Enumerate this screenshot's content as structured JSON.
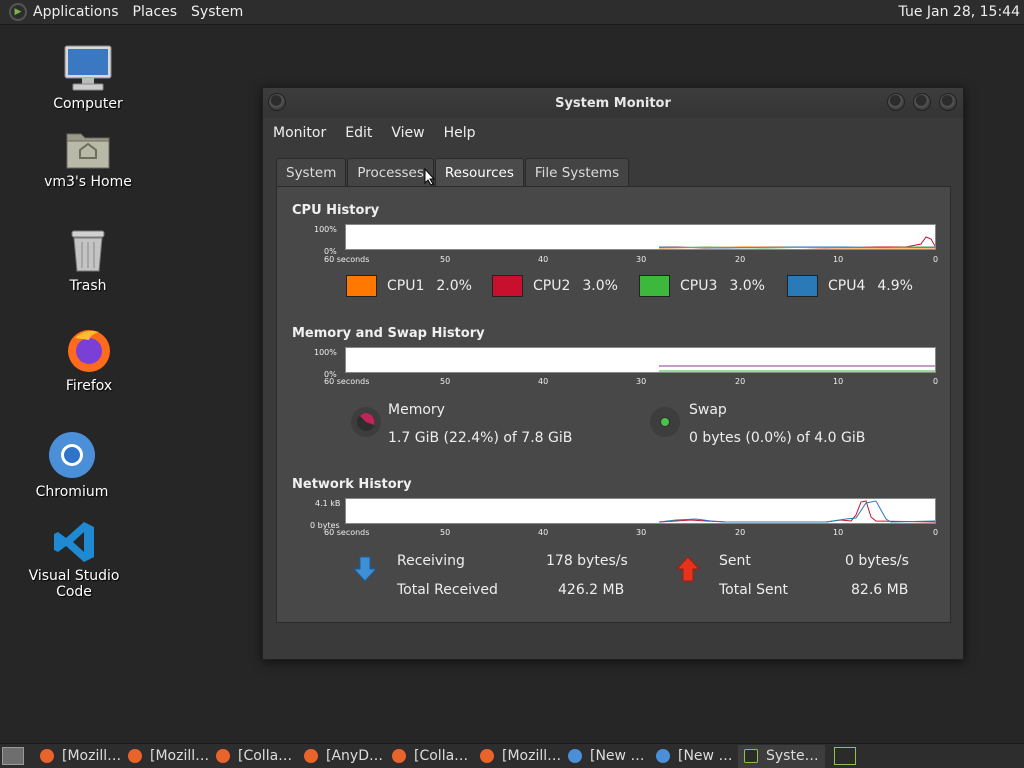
{
  "top_panel": {
    "menus": [
      "Applications",
      "Places",
      "System"
    ],
    "clock": "Tue Jan 28, 15:44"
  },
  "desktop_icons": [
    {
      "label": "Computer",
      "icon": "computer-icon"
    },
    {
      "label": "vm3's Home",
      "icon": "home-folder-icon"
    },
    {
      "label": "Trash",
      "icon": "trash-icon"
    },
    {
      "label": "Firefox",
      "icon": "firefox-icon"
    },
    {
      "label": "Chromium",
      "icon": "chromium-icon"
    },
    {
      "label": "Visual Studio Code",
      "icon": "vscode-icon"
    }
  ],
  "window": {
    "title": "System Monitor",
    "menubar": [
      "Monitor",
      "Edit",
      "View",
      "Help"
    ],
    "tabs": [
      "System",
      "Processes",
      "Resources",
      "File Systems"
    ],
    "active_tab": "Resources",
    "cpu": {
      "title": "CPU History",
      "y_top": "100%",
      "y_bottom": "0%",
      "x_labels": [
        "60 seconds",
        "50",
        "40",
        "30",
        "20",
        "10",
        "0"
      ],
      "legend": [
        {
          "name": "CPU1",
          "value": "2.0%",
          "color": "#ff7800"
        },
        {
          "name": "CPU2",
          "value": "3.0%",
          "color": "#c8102e"
        },
        {
          "name": "CPU3",
          "value": "3.0%",
          "color": "#3cb93c"
        },
        {
          "name": "CPU4",
          "value": "4.9%",
          "color": "#2a7ab8"
        }
      ]
    },
    "memory": {
      "title": "Memory and Swap History",
      "y_top": "100%",
      "y_bottom": "0%",
      "x_labels": [
        "60 seconds",
        "50",
        "40",
        "30",
        "20",
        "10",
        "0"
      ],
      "memory_label": "Memory",
      "memory_value": "1.7 GiB (22.4%) of 7.8 GiB",
      "memory_fraction": 0.224,
      "swap_label": "Swap",
      "swap_value": "0 bytes (0.0%) of 4.0 GiB",
      "swap_fraction": 0.0
    },
    "network": {
      "title": "Network History",
      "y_top": "4.1 kB",
      "y_bottom": "0 bytes",
      "x_labels": [
        "60 seconds",
        "50",
        "40",
        "30",
        "20",
        "10",
        "0"
      ],
      "receiving_label": "Receiving",
      "receiving_value": "178 bytes/s",
      "total_received_label": "Total Received",
      "total_received_value": "426.2 MB",
      "sent_label": "Sent",
      "sent_value": "0 bytes/s",
      "total_sent_label": "Total Sent",
      "total_sent_value": "82.6 MB"
    }
  },
  "taskbar": [
    {
      "label": "[Mozill…",
      "icon": "firefox-icon"
    },
    {
      "label": "[Mozill…",
      "icon": "firefox-icon"
    },
    {
      "label": "[Colla…",
      "icon": "firefox-icon"
    },
    {
      "label": "[AnyD…",
      "icon": "firefox-icon"
    },
    {
      "label": "[Colla…",
      "icon": "firefox-icon"
    },
    {
      "label": "[Mozill…",
      "icon": "firefox-icon"
    },
    {
      "label": "[New …",
      "icon": "chromium-icon"
    },
    {
      "label": "[New …",
      "icon": "chromium-icon"
    },
    {
      "label": "Syste…",
      "icon": "system-monitor-icon"
    }
  ]
}
